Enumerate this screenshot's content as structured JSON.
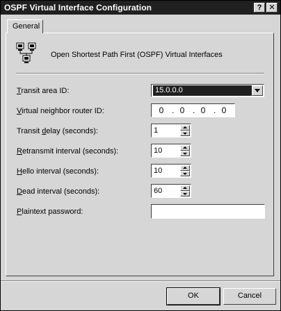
{
  "window": {
    "title": "OSPF Virtual Interface Configuration",
    "help_label": "?",
    "close_label": "✕"
  },
  "tabs": [
    {
      "label": "General"
    }
  ],
  "header": {
    "icon": "network-computers-icon",
    "text": "Open Shortest Path First (OSPF) Virtual Interfaces"
  },
  "fields": {
    "transit_area": {
      "label_accel": "T",
      "label_rest": "ransit area ID:",
      "value": "15.0.0.0"
    },
    "neighbor_router": {
      "label_accel": "V",
      "label_rest": "irtual neighbor router ID:",
      "octets": [
        "0",
        "0",
        "0",
        "0"
      ]
    },
    "transit_delay": {
      "label_pre": "Transit ",
      "label_accel": "d",
      "label_rest": "elay (seconds):",
      "value": "1"
    },
    "retransmit": {
      "label_accel": "R",
      "label_rest": "etransmit interval (seconds):",
      "value": "10"
    },
    "hello": {
      "label_accel": "H",
      "label_rest": "ello interval (seconds):",
      "value": "10"
    },
    "dead": {
      "label_accel": "D",
      "label_rest": "ead interval (seconds):",
      "value": "60"
    },
    "password": {
      "label_accel": "P",
      "label_rest": "laintext password:",
      "value": ""
    }
  },
  "buttons": {
    "ok": "OK",
    "cancel": "Cancel"
  }
}
